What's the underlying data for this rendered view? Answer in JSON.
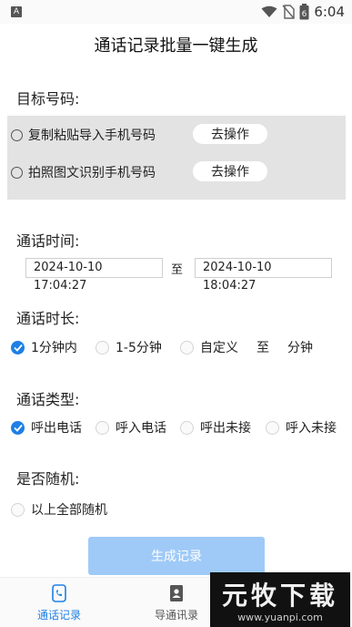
{
  "status_bar": {
    "left_badge": "A",
    "time": "6:04",
    "battery_level": "6",
    "icons": [
      "wifi-icon",
      "no-sim-icon",
      "battery-icon"
    ]
  },
  "app_title": "通话记录批量一键生成",
  "target": {
    "title": "目标号码:",
    "options": [
      {
        "label": "复制粘贴导入手机号码",
        "button": "去操作"
      },
      {
        "label": "拍照图文识别手机号码",
        "button": "去操作"
      }
    ]
  },
  "call_time": {
    "title": "通话时间:",
    "start": "2024-10-10 17:04:27",
    "separator": "至",
    "end": "2024-10-10 18:04:27"
  },
  "duration": {
    "title": "通话时长:",
    "options": [
      "1分钟内",
      "1-5分钟",
      "自定义"
    ],
    "selected": "1分钟内",
    "custom_separator": "至",
    "custom_unit": "分钟"
  },
  "call_type": {
    "title": "通话类型:",
    "options": [
      "呼出电话",
      "呼入电话",
      "呼出未接",
      "呼入未接"
    ],
    "selected": "呼出电话"
  },
  "random": {
    "title": "是否随机:",
    "option": "以上全部随机"
  },
  "generate_button": "生成记录",
  "bottom_nav": {
    "items": [
      {
        "label": "通话记录",
        "icon": "call-log-icon",
        "active": true
      },
      {
        "label": "导通讯录",
        "icon": "contacts-icon",
        "active": false
      }
    ]
  },
  "watermark": {
    "brand": "元牧下载",
    "url": "www.yuanpi.com"
  },
  "colors": {
    "accent": "#1e7fe6",
    "button_disabled": "#9fcaf7",
    "panel_bg": "#e3e3e3",
    "nav_active": "#1e7fe6",
    "nav_inactive": "#666666"
  }
}
